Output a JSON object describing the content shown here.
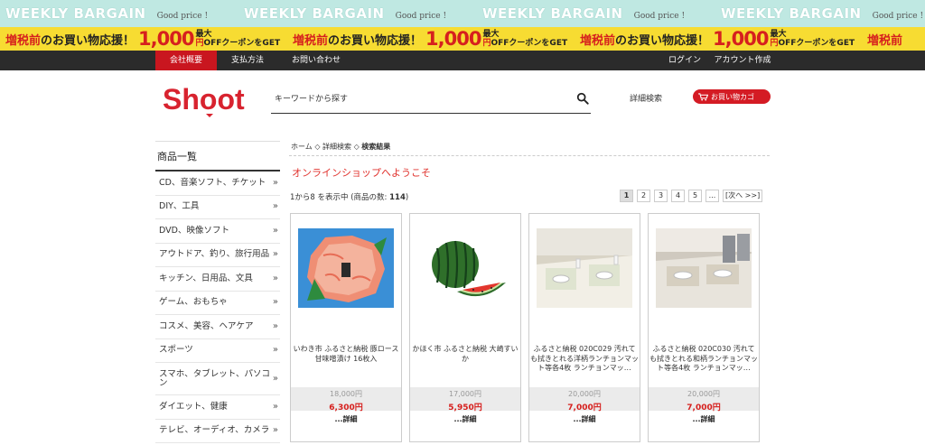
{
  "banner_top": {
    "headline": "WEEKLY BARGAIN",
    "tagline": "Good price !"
  },
  "banner_promo": {
    "lead_red": "増税前",
    "lead_rest": "のお買い物応援！",
    "amount": "1,000",
    "tail_line1": "最大",
    "tail_line2_red": "円",
    "tail_line2": "OFFクーポンをGET"
  },
  "nav": {
    "items": [
      "会社概要",
      "支払方法",
      "お問い合わせ"
    ],
    "login": "ログイン",
    "account": "アカウント作成"
  },
  "header": {
    "logo_text": "Shoot",
    "search_placeholder": "キーワードから探す",
    "advanced_search": "詳細検索",
    "cart_label": "お買い物カゴ"
  },
  "sidebar": {
    "title": "商品一覧",
    "items": [
      "CD、音楽ソフト、チケット",
      "DIY、工具",
      "DVD、映像ソフト",
      "アウトドア、釣り、旅行用品",
      "キッチン、日用品、文具",
      "ゲーム、おもちゃ",
      "コスメ、美容、ヘアケア",
      "スポーツ",
      "スマホ、タブレット、パソコン",
      "ダイエット、健康",
      "テレビ、オーディオ、カメラ"
    ]
  },
  "breadcrumb": {
    "home": "ホーム",
    "advanced": "詳細検索",
    "current": "検索結果",
    "separator": "◇"
  },
  "welcome": "オンラインショップへようこそ",
  "results": {
    "prefix": "1から8 を表示中 (商品の数: ",
    "count": "114",
    "suffix": ")"
  },
  "pagination": {
    "pages": [
      "1",
      "2",
      "3",
      "4",
      "5",
      "..."
    ],
    "next": "[次へ >>]",
    "current": "1"
  },
  "products": [
    {
      "name": "いわき市 ふるさと納税 豚ロース甘味噌漬け 16枚入",
      "old_price": "18,000円",
      "price": "6,300円",
      "detail": "...詳細",
      "image": "pork"
    },
    {
      "name": "かほく市 ふるさと納税 大崎すいか",
      "old_price": "17,000円",
      "price": "5,950円",
      "detail": "...詳細",
      "image": "watermelon"
    },
    {
      "name": "ふるさと納税 020C029 汚れても拭きとれる洋柄ランチョンマット等各4枚 ランチョンマッ…",
      "old_price": "20,000円",
      "price": "7,000円",
      "detail": "...詳細",
      "image": "table-set-1"
    },
    {
      "name": "ふるさと納税 020C030 汚れても拭きとれる和柄ランチョンマット等各4枚 ランチョンマッ…",
      "old_price": "20,000円",
      "price": "7,000円",
      "detail": "...詳細",
      "image": "table-set-2"
    }
  ],
  "colors": {
    "banner_top_bg": "#bfe8e2",
    "banner_promo_bg": "#f7dc32",
    "nav_bg": "#2b2b2b",
    "accent_red": "#d41b24"
  }
}
